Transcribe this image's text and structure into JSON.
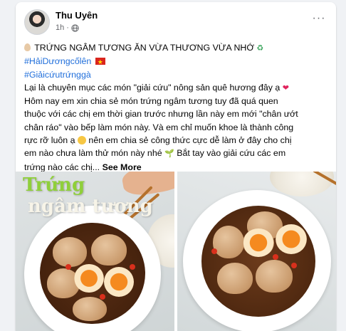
{
  "post": {
    "author": "Thu Uyên",
    "time": "1h",
    "more_label": "···",
    "lines": [
      "TRỨNG NGÂM TƯƠNG ĂN VỪA THƯƠNG VỪA NHỚ",
      "#HảiDươngcốlên",
      "#Giảicứutrứnggà",
      "Lại là chuyên mục các món \"giải cứu\" nông sản quê hương đây ạ",
      "Hôm nay em xin chia sẻ món trứng ngâm tương tuy đã quá quen",
      "thuộc với các chị em thời gian trước nhưng lần này em mới \"chân ướt",
      "chân ráo\" vào bếp làm món này. Và em chỉ muốn khoe là thành công",
      "rực rỡ luôn ạ",
      "nên em chia sẻ công thức cực dễ làm ở đây cho chị",
      "em nào chưa làm thử món này nhé",
      "Bắt tay vào giải cứu các em",
      "trứng nào các chị..."
    ],
    "see_more": "See More"
  },
  "photos": {
    "left_title_1": "Trứng",
    "left_title_2": "ngâm tương"
  },
  "icons": {
    "globe": "globe-icon",
    "more": "more-options-icon",
    "egg": "egg-emoji",
    "recycle": "recycle-emoji",
    "flag": "vietnam-flag-emoji",
    "heart": "red-heart-emoji",
    "laugh": "laughing-emoji",
    "seedling": "seedling-emoji"
  },
  "colors": {
    "hashtag": "#216fdb",
    "secondary_text": "#65676b",
    "primary_text": "#050505"
  }
}
